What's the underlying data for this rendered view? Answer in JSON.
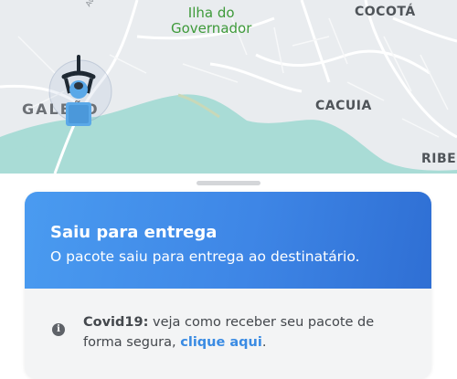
{
  "map": {
    "labels": {
      "ilha_line1": "Ilha do",
      "ilha_line2": "Governador",
      "cocota": "COCOTÁ",
      "galeao": "GALEÃO",
      "cacuia": "CACUIA",
      "ribeira": "RIBE",
      "street": "Av. Bra"
    },
    "colors": {
      "land": "#e9ecef",
      "water": "#a9dcd6",
      "road": "#ffffff",
      "courier_blue": "#5aa8e8"
    }
  },
  "status_card": {
    "title": "Saiu para entrega",
    "description": "O pacote saiu para entrega ao destinatário.",
    "gradient_colors": [
      "#4a9bf0",
      "#2f6fd4"
    ]
  },
  "notice": {
    "icon": "info-icon",
    "prefix": "Covid19:",
    "text": " veja como receber seu pacote de forma segura, ",
    "link_label": "clique aqui",
    "suffix": "."
  }
}
